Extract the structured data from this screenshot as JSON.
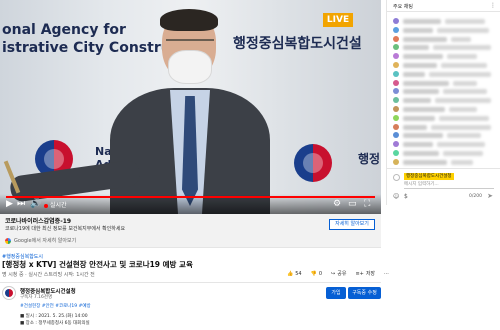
{
  "player": {
    "banner_line1": "onal Agency for",
    "banner_line2": "istrative City Construction",
    "banner_korean": "행정중심복합도시건설",
    "banner_korean_right": "행정",
    "nat_text": "Nat\nAd",
    "live_badge": "LIVE",
    "controls": {
      "play_icon": "▶",
      "next_icon": "⏭",
      "volume_icon": "🔊",
      "live_label": "실시간",
      "right_icons": [
        "⚙",
        "▭",
        "⛶"
      ]
    },
    "progress": 1.0
  },
  "info_card": {
    "title": "코로나바이러스감염증-19",
    "description": "코로나19에 대한 최신 정보를 보건복지부에서 확인하세요",
    "button_label": "자세히 알아보기",
    "google_text": "Google에서 자세히 알아보기"
  },
  "video": {
    "hashtags": "#행정중심복합도시",
    "title": "[행정청 x KTV] 건설현장 안전사고 및 코로나19 예방 교육",
    "meta": "명 시청 중 · 실시간 스트리밍 시작: 1시간 전",
    "likes": "54",
    "dislikes": "0",
    "share_label": "공유",
    "save_label": "저장",
    "more_label": "···"
  },
  "channel": {
    "name": "행정중심복합도시건설청",
    "subscribers": "구독자 7.16천명",
    "join_label": "가입",
    "subscribe_label": "구독중 수정",
    "desc_tags": "#건설현장 #안전 #코로나19 #예방",
    "desc_line1": "■ 일시 : 2021. 5. 25.(화) 14:00",
    "desc_line2": "■ 장소 : 정부세종청사 6동 대회의실"
  },
  "chat": {
    "header_title": "주요 채팅",
    "header_more": "⋮",
    "my_name": "행정중심복합도시건설청",
    "input_placeholder": "메시지 입력하기...",
    "char_count": "0/200",
    "emoji_icon": "☺",
    "money_icon": "$",
    "send_icon": "➤",
    "avatar_colors": [
      "#8e7dd6",
      "#5aa0e0",
      "#e07b5a",
      "#6bbf7d",
      "#b97ad6",
      "#e0b35a",
      "#5ac2c2",
      "#d65a8e",
      "#7d8ed6",
      "#6bbf9d",
      "#c2955a",
      "#8ed65a",
      "#d67d5a",
      "#5a8ed6",
      "#a07ad6",
      "#5ad6a0",
      "#d6b35a"
    ],
    "highlight_color": "#fdd000",
    "accent": "#065fd4"
  }
}
